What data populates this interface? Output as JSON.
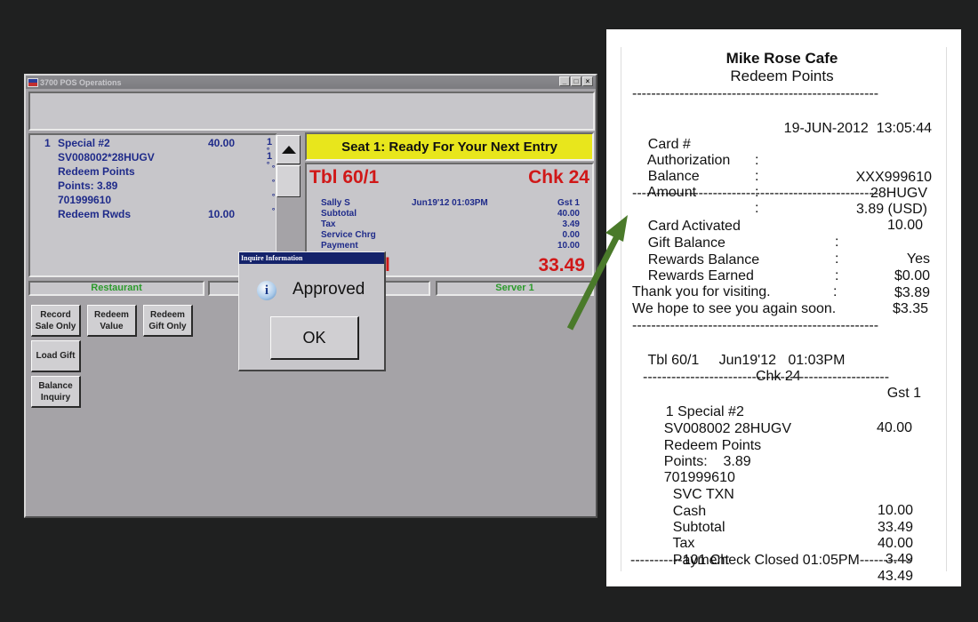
{
  "pos": {
    "title": "3700 POS Operations",
    "window_controls": {
      "minimize": "_",
      "maximize": "□",
      "close": "×"
    },
    "order_lines": [
      {
        "qty": "1",
        "name": "Special #2",
        "amount": "40.00",
        "mark": "1 ˚"
      },
      {
        "qty": "",
        "name": "SV008002*28HUGV",
        "amount": "",
        "mark": "1 ˚"
      },
      {
        "qty": "",
        "name": "Redeem Points",
        "amount": "",
        "mark": "˚"
      },
      {
        "qty": "",
        "name": "Points: 3.89",
        "amount": "",
        "mark": "˚"
      },
      {
        "qty": "",
        "name": "701999610",
        "amount": "",
        "mark": "˚"
      },
      {
        "qty": "",
        "name": "Redeem Rwds",
        "amount": "10.00",
        "mark": "˚"
      }
    ],
    "prompt": "Seat 1: Ready For Your Next Entry",
    "check": {
      "table": "Tbl 60/1",
      "check_no": "Chk 24",
      "employee": "Sally S",
      "datetime": "Jun19'12 01:03PM",
      "guest": "Gst 1",
      "labels": [
        "Subtotal",
        "Tax",
        "Service Chrg",
        "Payment"
      ],
      "values": [
        "40.00",
        "3.49",
        "0.00",
        "10.00"
      ],
      "total_due": "33.49",
      "total_label_fragment": "l"
    },
    "status_bar": {
      "left": "Restaurant",
      "middle": "",
      "right": "Server 1"
    },
    "buttons": [
      {
        "label": "Record Sale Only"
      },
      {
        "label": "Redeem Value"
      },
      {
        "label": "Redeem Gift Only"
      },
      {
        "label": "Load Gift"
      },
      {
        "label": "Balance Inquiry"
      }
    ],
    "dialog": {
      "title": "Inquire Information",
      "message": "Approved",
      "ok_label": "OK",
      "icon": "info-icon"
    }
  },
  "receipt": {
    "store_name": "Mike Rose Cafe",
    "subtitle": "Redeem Points",
    "dashes": "----------------------------------------------------",
    "timestamp": "19-JUN-2012  13:05:44",
    "card_fields": [
      {
        "label": "Card #",
        "value": "XXX999610"
      },
      {
        "label": "Authorization",
        "value": "28HUGV"
      },
      {
        "label": "Balance",
        "value": "3.89 (USD)"
      },
      {
        "label": "Amount",
        "value": "10.00"
      }
    ],
    "account_fields": [
      {
        "label": "Card Activated",
        "value": "Yes"
      },
      {
        "label": "Gift Balance",
        "value": "$0.00"
      },
      {
        "label": "Rewards Balance",
        "value": "$3.89"
      },
      {
        "label": "Rewards Earned",
        "value": "$3.35"
      }
    ],
    "thanks_1": "Thank you for visiting.",
    "thanks_2": "We hope to see you again soon.",
    "table": "Tbl 60/1",
    "check": "Chk 24",
    "guest": "Gst 1",
    "check_datetime": "Jun19'12   01:03PM",
    "items": [
      {
        "label": "1 Special #2",
        "value": "40.00"
      },
      {
        "label": "SV008002 28HUGV",
        "value": ""
      },
      {
        "label": "Redeem Points",
        "value": ""
      },
      {
        "label": "Points:    3.89",
        "value": ""
      },
      {
        "label": "701999610",
        "value": ""
      }
    ],
    "totals": [
      {
        "label": "SVC TXN",
        "value": "10.00"
      },
      {
        "label": "Cash",
        "value": "33.49"
      },
      {
        "label": "Subtotal",
        "value": "40.00"
      },
      {
        "label": "Tax",
        "value": "3.49"
      },
      {
        "label": "Payment",
        "value": "43.49"
      }
    ],
    "footer": "-----------101 Check Closed 01:05PM-----------"
  },
  "annotation": {
    "arrow_color": "#4a7a2a"
  }
}
